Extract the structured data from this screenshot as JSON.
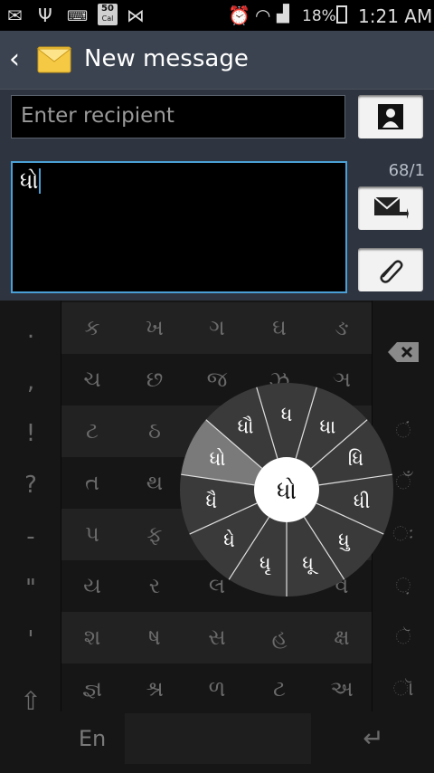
{
  "status_bar": {
    "notification_badge": "50",
    "notification_badge_sub": "Cal",
    "battery_pct": "18%",
    "time": "1:21 AM"
  },
  "header": {
    "title": "New message"
  },
  "recipient": {
    "placeholder": "Enter recipient"
  },
  "compose": {
    "text": "ધો",
    "counter": "68/1"
  },
  "keyboard": {
    "left_keys": [
      ".",
      ",",
      "!",
      "?",
      "-",
      "\"",
      "'"
    ],
    "rows": [
      [
        "ક",
        "ખ",
        "ગ",
        "ઘ",
        "ઙ"
      ],
      [
        "ચ",
        "છ",
        "જ",
        "ઝ",
        "ઞ"
      ],
      [
        "ટ",
        "ઠ",
        "ડ",
        "ઢ",
        "ણ"
      ],
      [
        "ત",
        "થ",
        "દ",
        "ધ",
        "ન"
      ],
      [
        "પ",
        "ફ",
        "બ",
        "ભ",
        "મ"
      ],
      [
        "ય",
        "ર",
        "લ",
        "વ",
        "વ"
      ],
      [
        "શ",
        "ષ",
        "સ",
        "હ",
        "ક્ષ"
      ],
      [
        "જ્ઞ",
        "શ્ર",
        "ળ",
        "ટ",
        "અ"
      ]
    ],
    "right_keys": [
      "ં",
      "ઁ",
      "ઃ",
      "઼",
      "ૅ",
      "ૉ"
    ],
    "lang_key": "En",
    "wheel": {
      "center": "ધો",
      "items": [
        "ધ",
        "ધા",
        "ધિ",
        "ધી",
        "ધુ",
        "ધૂ",
        "ધૃ",
        "ધે",
        "ધૈ",
        "ધો",
        "ધૌ"
      ],
      "highlight_index": 9
    }
  }
}
